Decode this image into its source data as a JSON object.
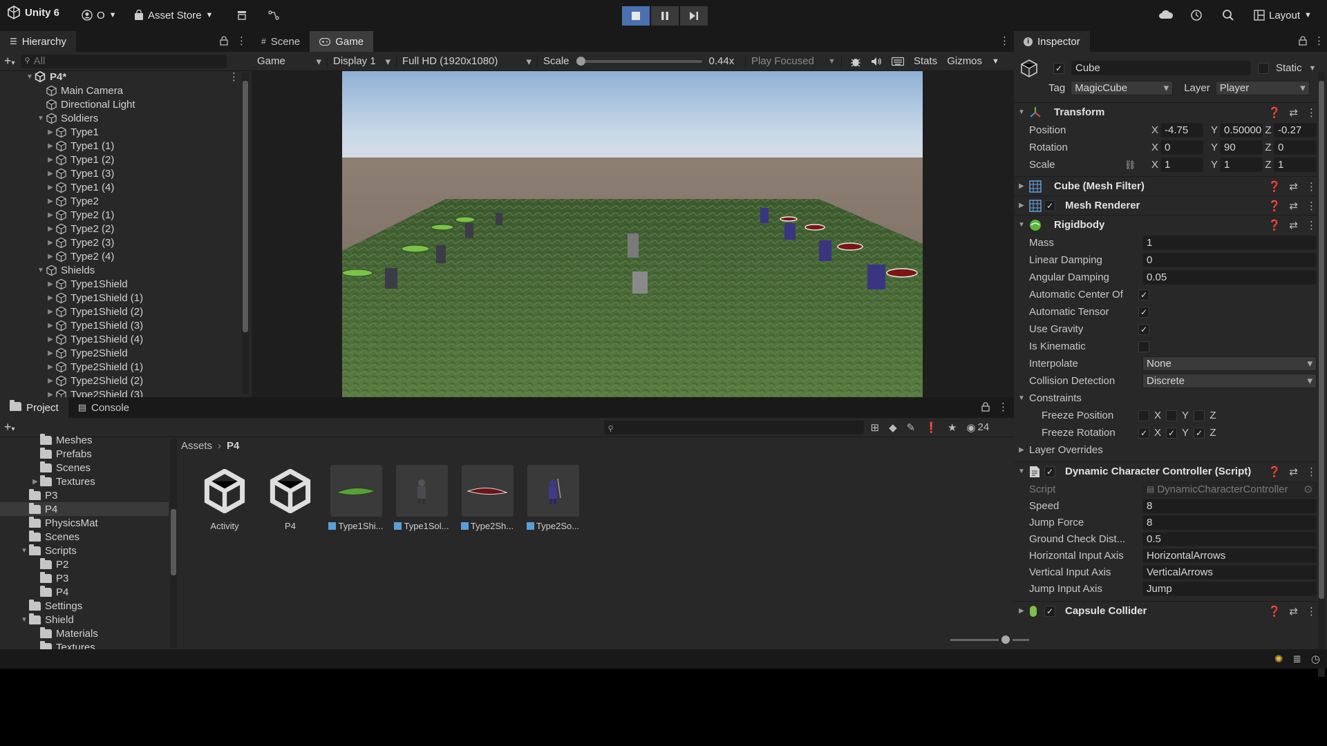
{
  "toolbar": {
    "app_title": "Unity 6",
    "account_label": "O",
    "asset_store_label": "Asset Store",
    "layout_label": "Layout"
  },
  "hierarchy": {
    "tab_label": "Hierarchy",
    "search_placeholder": "All",
    "scene_name": "P4*",
    "items": [
      {
        "label": "Main Camera",
        "depth": 1,
        "expand": "none"
      },
      {
        "label": "Directional Light",
        "depth": 1,
        "expand": "none"
      },
      {
        "label": "Soldiers",
        "depth": 1,
        "expand": "open"
      },
      {
        "label": "Type1",
        "depth": 2,
        "expand": "closed"
      },
      {
        "label": "Type1 (1)",
        "depth": 2,
        "expand": "closed"
      },
      {
        "label": "Type1 (2)",
        "depth": 2,
        "expand": "closed"
      },
      {
        "label": "Type1 (3)",
        "depth": 2,
        "expand": "closed"
      },
      {
        "label": "Type1 (4)",
        "depth": 2,
        "expand": "closed"
      },
      {
        "label": "Type2",
        "depth": 2,
        "expand": "closed"
      },
      {
        "label": "Type2 (1)",
        "depth": 2,
        "expand": "closed"
      },
      {
        "label": "Type2 (2)",
        "depth": 2,
        "expand": "closed"
      },
      {
        "label": "Type2 (3)",
        "depth": 2,
        "expand": "closed"
      },
      {
        "label": "Type2 (4)",
        "depth": 2,
        "expand": "closed"
      },
      {
        "label": "Shields",
        "depth": 1,
        "expand": "open"
      },
      {
        "label": "Type1Shield",
        "depth": 2,
        "expand": "closed"
      },
      {
        "label": "Type1Shield (1)",
        "depth": 2,
        "expand": "closed"
      },
      {
        "label": "Type1Shield (2)",
        "depth": 2,
        "expand": "closed"
      },
      {
        "label": "Type1Shield (3)",
        "depth": 2,
        "expand": "closed"
      },
      {
        "label": "Type1Shield (4)",
        "depth": 2,
        "expand": "closed"
      },
      {
        "label": "Type2Shield",
        "depth": 2,
        "expand": "closed"
      },
      {
        "label": "Type2Shield (1)",
        "depth": 2,
        "expand": "closed"
      },
      {
        "label": "Type2Shield (2)",
        "depth": 2,
        "expand": "closed"
      },
      {
        "label": "Type2Shield (3)",
        "depth": 2,
        "expand": "closed"
      }
    ]
  },
  "game_view": {
    "scene_tab": "Scene",
    "game_tab": "Game",
    "view_select": "Game",
    "display_select": "Display 1",
    "resolution_select": "Full HD (1920x1080)",
    "scale_label": "Scale",
    "scale_value": "0.44x",
    "scale_fraction": 0.0,
    "play_mode_select": "Play Focused",
    "stats_label": "Stats",
    "gizmos_label": "Gizmos"
  },
  "project": {
    "project_tab": "Project",
    "console_tab": "Console",
    "breadcrumb_root": "Assets",
    "breadcrumb_current": "P4",
    "hidden_count": "24",
    "tree": [
      {
        "label": "Meshes",
        "depth": 2,
        "expand": "none"
      },
      {
        "label": "Prefabs",
        "depth": 2,
        "expand": "none"
      },
      {
        "label": "Scenes",
        "depth": 2,
        "expand": "none"
      },
      {
        "label": "Textures",
        "depth": 2,
        "expand": "closed"
      },
      {
        "label": "P3",
        "depth": 1,
        "expand": "none"
      },
      {
        "label": "P4",
        "depth": 1,
        "expand": "none",
        "selected": true
      },
      {
        "label": "PhysicsMat",
        "depth": 1,
        "expand": "none"
      },
      {
        "label": "Scenes",
        "depth": 1,
        "expand": "none"
      },
      {
        "label": "Scripts",
        "depth": 1,
        "expand": "open"
      },
      {
        "label": "P2",
        "depth": 2,
        "expand": "none"
      },
      {
        "label": "P3",
        "depth": 2,
        "expand": "none"
      },
      {
        "label": "P4",
        "depth": 2,
        "expand": "none"
      },
      {
        "label": "Settings",
        "depth": 1,
        "expand": "none"
      },
      {
        "label": "Shield",
        "depth": 1,
        "expand": "open"
      },
      {
        "label": "Materials",
        "depth": 2,
        "expand": "none"
      },
      {
        "label": "Textures",
        "depth": 2,
        "expand": "none"
      }
    ],
    "assets": [
      {
        "label": "Activity",
        "kind": "scene",
        "thumb": "unity-logo-icon"
      },
      {
        "label": "P4",
        "kind": "scene",
        "thumb": "unity-logo-icon"
      },
      {
        "label": "Type1Shi...",
        "kind": "prefab",
        "thumb": "green-shield-icon"
      },
      {
        "label": "Type1Sol...",
        "kind": "prefab",
        "thumb": "soldier-grey-icon"
      },
      {
        "label": "Type2Sh...",
        "kind": "prefab",
        "thumb": "red-shield-icon"
      },
      {
        "label": "Type2So...",
        "kind": "prefab",
        "thumb": "soldier-blue-icon"
      }
    ]
  },
  "inspector": {
    "tab_label": "Inspector",
    "object_name": "Cube",
    "static_label": "Static",
    "tag_label": "Tag",
    "tag_value": "MagicCube",
    "layer_label": "Layer",
    "layer_value": "Player",
    "transform": {
      "title": "Transform",
      "position_label": "Position",
      "rotation_label": "Rotation",
      "scale_label": "Scale",
      "position": {
        "x": "-4.75",
        "y": "0.50000",
        "z": "-0.27"
      },
      "rotation": {
        "x": "0",
        "y": "90",
        "z": "0"
      },
      "scale": {
        "x": "1",
        "y": "1",
        "z": "1"
      }
    },
    "mesh_filter_title": "Cube (Mesh Filter)",
    "mesh_renderer_title": "Mesh Renderer",
    "rigidbody": {
      "title": "Rigidbody",
      "mass_label": "Mass",
      "mass": "1",
      "linear_damping_label": "Linear Damping",
      "linear_damping": "0",
      "angular_damping_label": "Angular Damping",
      "angular_damping": "0.05",
      "auto_com_label": "Automatic Center Of M",
      "auto_tensor_label": "Automatic Tensor",
      "use_gravity_label": "Use Gravity",
      "is_kinematic_label": "Is Kinematic",
      "interpolate_label": "Interpolate",
      "interpolate": "None",
      "collision_label": "Collision Detection",
      "collision": "Discrete",
      "constraints_label": "Constraints",
      "freeze_pos_label": "Freeze Position",
      "freeze_rot_label": "Freeze Rotation",
      "layer_overrides_label": "Layer Overrides",
      "axis_x": "X",
      "axis_y": "Y",
      "axis_z": "Z"
    },
    "script": {
      "title": "Dynamic Character Controller (Script)",
      "script_label": "Script",
      "script_value": "DynamicCharacterController",
      "speed_label": "Speed",
      "speed": "8",
      "jump_force_label": "Jump Force",
      "jump_force": "8",
      "ground_check_label": "Ground Check Dist...",
      "ground_check": "0.5",
      "h_axis_label": "Horizontal Input Axis",
      "h_axis": "HorizontalArrows",
      "v_axis_label": "Vertical Input Axis",
      "v_axis": "VerticalArrows",
      "jump_axis_label": "Jump Input Axis",
      "jump_axis": "Jump"
    },
    "capsule_title": "Capsule Collider"
  },
  "colors": {
    "accent": "#4a71b0",
    "panel": "#282828",
    "toolbar": "#191919",
    "grass": "#4a6a35",
    "sky": "#b8d0e6"
  }
}
